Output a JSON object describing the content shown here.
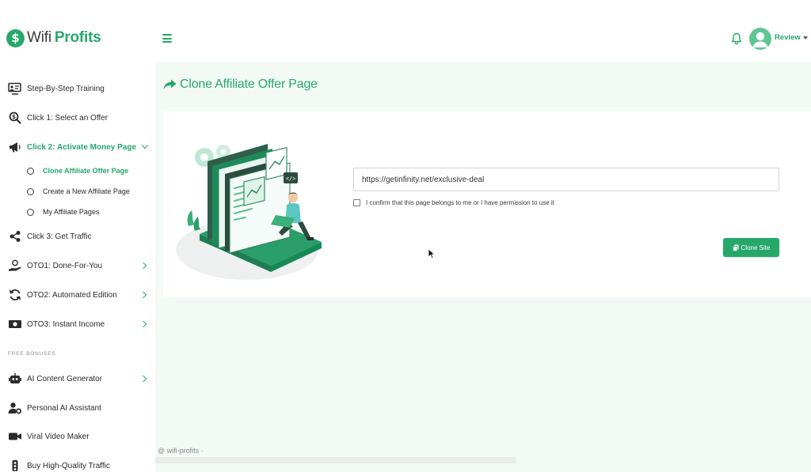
{
  "app": {
    "logo_prefix": "Wifi",
    "logo_suffix": "Profits",
    "user_name": "Review",
    "accent_color": "#27a86b"
  },
  "icons": {
    "logo": "dollar-coin-icon",
    "menu": "hamburger-icon",
    "notifications": "bell-icon",
    "user": "avatar-icon"
  },
  "sidebar": {
    "items": [
      {
        "label": "Step-By-Step Training",
        "icon": "monitor-training-icon"
      },
      {
        "label": "Click 1: Select an Offer",
        "icon": "search-dollar-icon"
      },
      {
        "label": "Click 2: Activate Money Page",
        "icon": "megaphone-icon",
        "active": true,
        "expanded": true
      },
      {
        "label": "Click 3: Get Traffic",
        "icon": "share-icon"
      },
      {
        "label": "OTO1: Done-For-You",
        "icon": "hand-coin-icon",
        "has_children": true
      },
      {
        "label": "OTO2: Automated Edition",
        "icon": "sync-icon",
        "has_children": true
      },
      {
        "label": "OTO3: Instant Income",
        "icon": "money-bill-icon",
        "has_children": true
      }
    ],
    "subitems": [
      {
        "label": "Clone Affiliate Offer Page",
        "active": true
      },
      {
        "label": "Create a New Affiliate Page"
      },
      {
        "label": "My Affiliate Pages"
      }
    ],
    "bonus_title": "FREE BONUSES",
    "bonus_items": [
      {
        "label": "AI Content Generator",
        "icon": "robot-icon",
        "has_children": true
      },
      {
        "label": "Personal AI Assistant",
        "icon": "user-gear-icon"
      },
      {
        "label": "Viral Video Maker",
        "icon": "video-camera-icon"
      },
      {
        "label": "Buy High-Quality Traffic",
        "icon": "traffic-icon"
      }
    ]
  },
  "main": {
    "title": "Clone Affiliate Offer Page",
    "title_icon": "share-arrow-icon",
    "url_value": "https://getinfinity.net/exclusive-deal",
    "confirm_label": "I confirm that this page belongs to me or I have permission to use it",
    "confirm_checked": false,
    "clone_button_label": "Clone Site",
    "clone_button_icon": "copy-icon",
    "illustration": "web-developer-illustration"
  },
  "footer": {
    "text": "@ wifi-profits ·"
  }
}
